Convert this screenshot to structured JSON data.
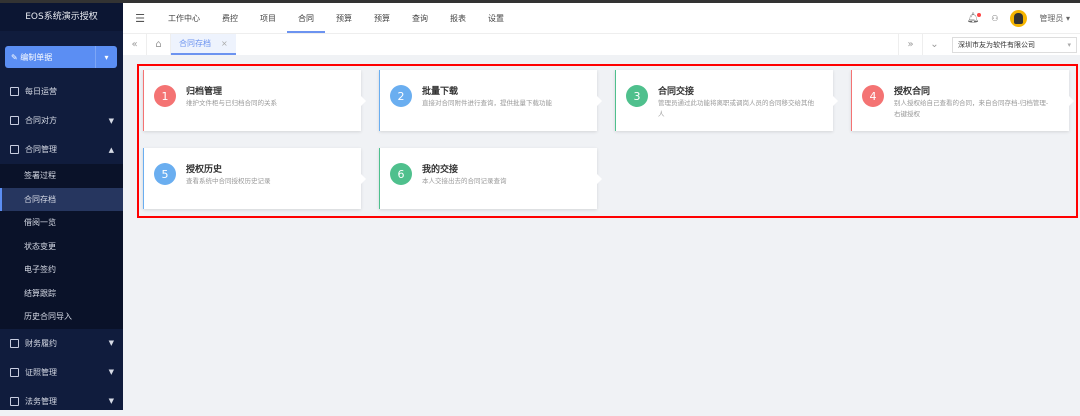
{
  "app": {
    "title": "EOS系统演示授权",
    "new_button": "编制单据"
  },
  "sidebar": {
    "items": [
      {
        "label": "每日运营",
        "arrow": ""
      },
      {
        "label": "合同对方",
        "arrow": "▼"
      },
      {
        "label": "合同管理",
        "arrow": "▲"
      }
    ],
    "sub_items": [
      "签署过程",
      "合同存档",
      "借阅一览",
      "状态变更",
      "电子签约",
      "结算跟踪",
      "历史合同导入"
    ],
    "items_after": [
      {
        "label": "财务履约",
        "arrow": "▼"
      },
      {
        "label": "证照管理",
        "arrow": "▼"
      },
      {
        "label": "法务管理",
        "arrow": "▼"
      }
    ]
  },
  "header": {
    "nav": [
      "工作中心",
      "费控",
      "项目",
      "合同",
      "预算",
      "预算",
      "查询",
      "报表",
      "设置"
    ],
    "active_nav": 3,
    "user": "管理员"
  },
  "tabs": {
    "open": [
      {
        "label": "合同存档"
      }
    ],
    "close": "×",
    "org": "深圳市友为软件有限公司"
  },
  "cards": [
    {
      "num": "1",
      "title": "归档管理",
      "desc": "维护文件柜与已归档合同的关系",
      "color": "#f47373"
    },
    {
      "num": "2",
      "title": "批量下载",
      "desc": "直接对合同附件进行查询，提供批量下载功能",
      "color": "#6aaef0"
    },
    {
      "num": "3",
      "title": "合同交接",
      "desc": "管理员通过此功能将离职或调岗人员的合同移交给其他人",
      "color": "#4fc08d"
    },
    {
      "num": "4",
      "title": "授权合同",
      "desc": "别人授权给自己查看的合同，来自合同存档-归档管理-右键授权",
      "color": "#f47373"
    },
    {
      "num": "5",
      "title": "授权历史",
      "desc": "查看系统中合同授权历史记录",
      "color": "#6aaef0"
    },
    {
      "num": "6",
      "title": "我的交接",
      "desc": "本人交接出去的合同记录查询",
      "color": "#4fc08d"
    }
  ]
}
